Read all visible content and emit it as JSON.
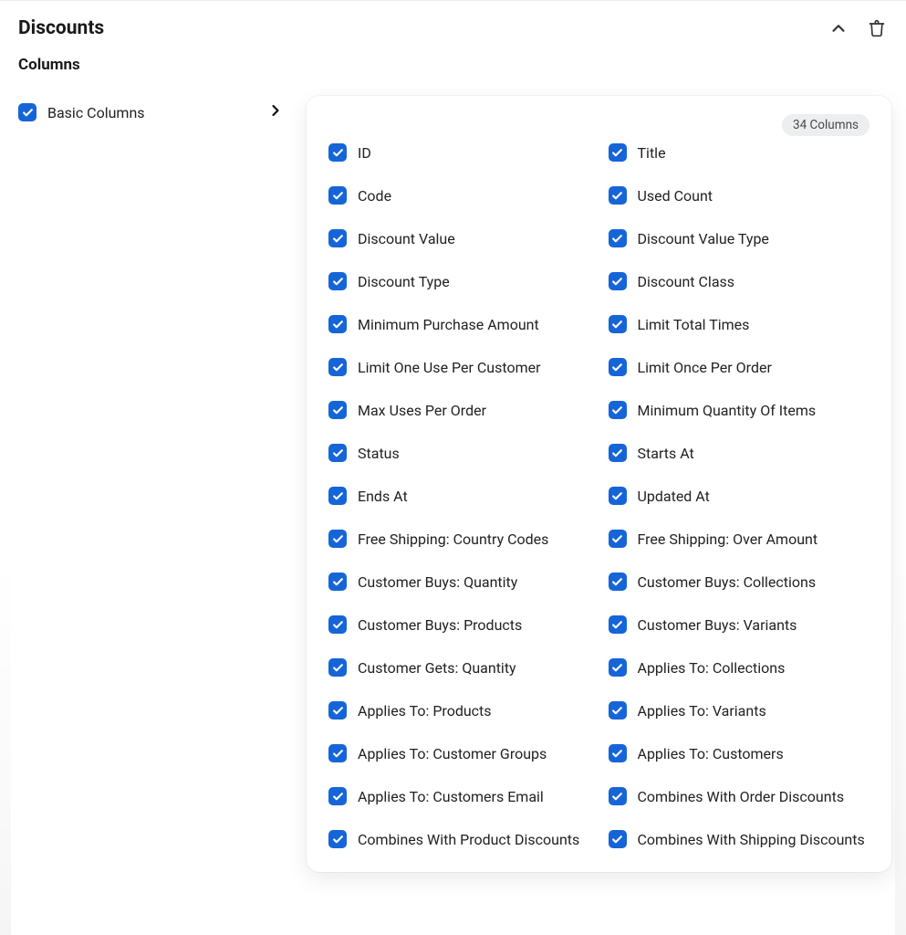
{
  "header": {
    "title": "Discounts",
    "subheader": "Columns"
  },
  "sidebar": {
    "item_label": "Basic Columns"
  },
  "badge": "34 Columns",
  "columns_left": [
    "ID",
    "Code",
    "Discount Value",
    "Discount Type",
    "Minimum Purchase Amount",
    "Limit One Use Per Customer",
    "Max Uses Per Order",
    "Status",
    "Ends At",
    "Free Shipping: Country Codes",
    "Customer Buys: Quantity",
    "Customer Buys: Products",
    "Customer Gets: Quantity",
    "Applies To: Products",
    "Applies To: Customer Groups",
    "Applies To: Customers Email",
    "Combines With Product Discounts"
  ],
  "columns_right": [
    "Title",
    "Used Count",
    "Discount Value Type",
    "Discount Class",
    "Limit Total Times",
    "Limit Once Per Order",
    "Minimum Quantity Of Items",
    "Starts At",
    "Updated At",
    "Free Shipping: Over Amount",
    "Customer Buys: Collections",
    "Customer Buys: Variants",
    "Applies To: Collections",
    "Applies To: Variants",
    "Applies To: Customers",
    "Combines With Order Discounts",
    "Combines With Shipping Discounts"
  ]
}
